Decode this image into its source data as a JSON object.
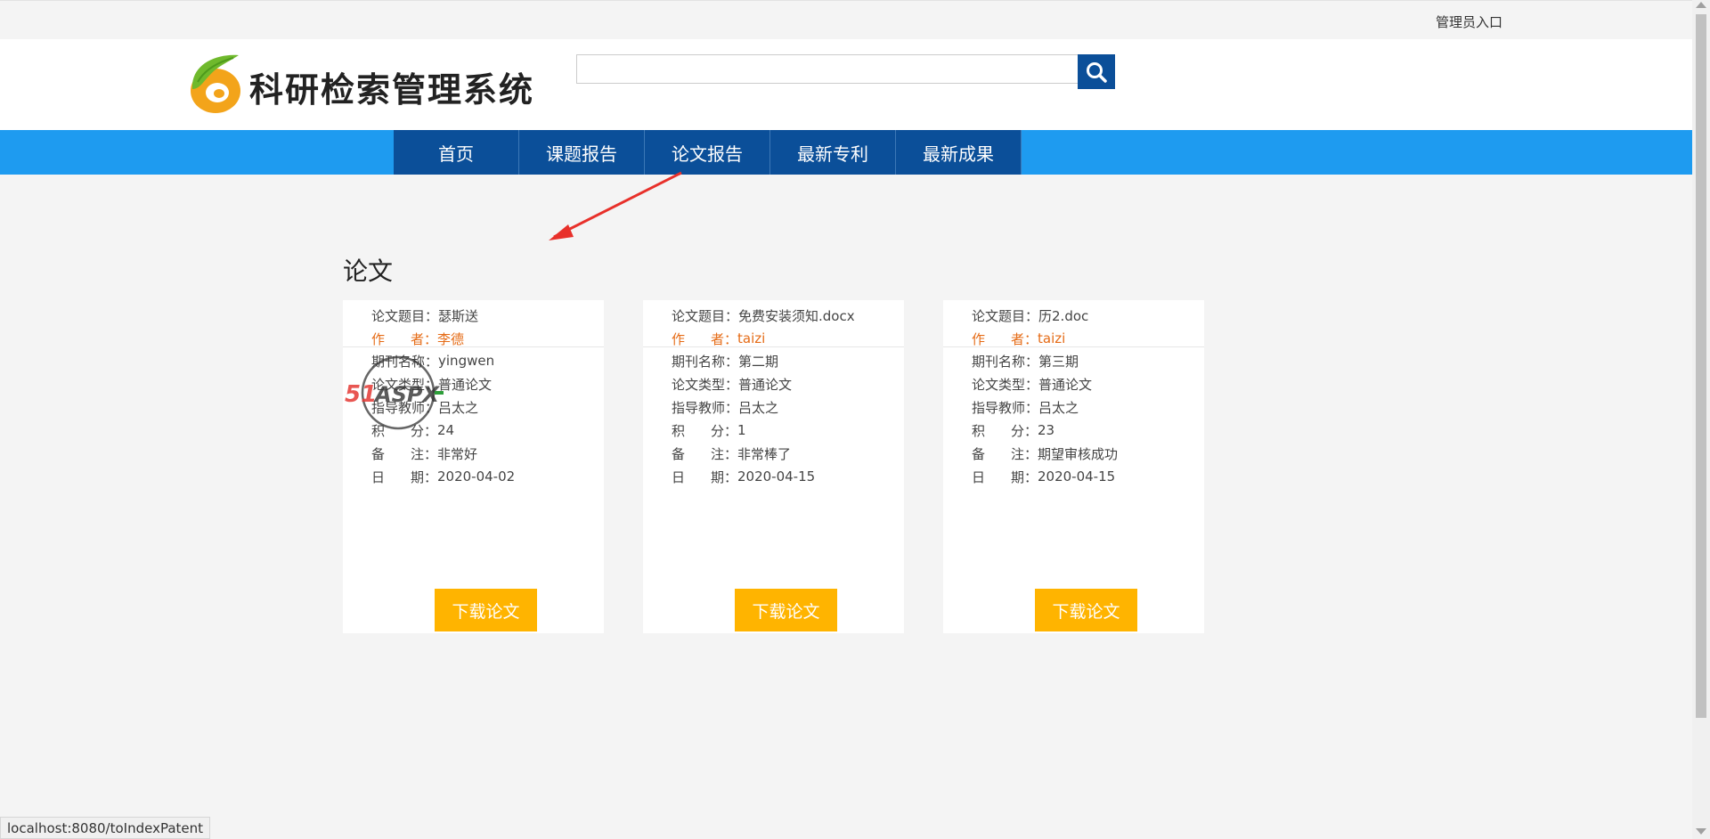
{
  "topbar": {
    "admin_link": "管理员入口"
  },
  "header": {
    "logo_text": "科研检索管理系统",
    "search": {
      "value": "",
      "placeholder": ""
    }
  },
  "nav": {
    "items": [
      {
        "label": "首页"
      },
      {
        "label": "课题报告"
      },
      {
        "label": "论文报告"
      },
      {
        "label": "最新专利"
      },
      {
        "label": "最新成果"
      }
    ]
  },
  "section": {
    "title": "论文"
  },
  "labels": {
    "title": "论文题目：",
    "author": [
      "作",
      "者："
    ],
    "journal": "期刊名称：",
    "type": "论文类型：",
    "advisor": "指导教师：",
    "score": [
      "积",
      "分："
    ],
    "remark": [
      "备",
      "注："
    ],
    "date": [
      "日",
      "期："
    ]
  },
  "cards": [
    {
      "title": "瑟斯送",
      "author": "李德",
      "journal": "yingwen",
      "type": "普通论文",
      "advisor": "吕太之",
      "score": "24",
      "remark": "非常好",
      "date": "2020-04-02",
      "button": "下载论文"
    },
    {
      "title": "免费安装须知.docx",
      "author": "taizi",
      "journal": "第二期",
      "type": "普通论文",
      "advisor": "吕太之",
      "score": "1",
      "remark": "非常棒了",
      "date": "2020-04-15",
      "button": "下载论文"
    },
    {
      "title": "历2.doc",
      "author": "taizi",
      "journal": "第三期",
      "type": "普通论文",
      "advisor": "吕太之",
      "score": "23",
      "remark": "期望审核成功",
      "date": "2020-04-15",
      "button": "下载论文"
    }
  ],
  "watermark": {
    "text": "51ASPX"
  },
  "statusbar": {
    "url": "localhost:8080/toIndexPatent"
  },
  "colors": {
    "nav_bar": "#1e9bf0",
    "nav_item": "#0b4f99",
    "download": "#ffb400",
    "author": "#e56b16",
    "arrow": "#e8302a"
  }
}
